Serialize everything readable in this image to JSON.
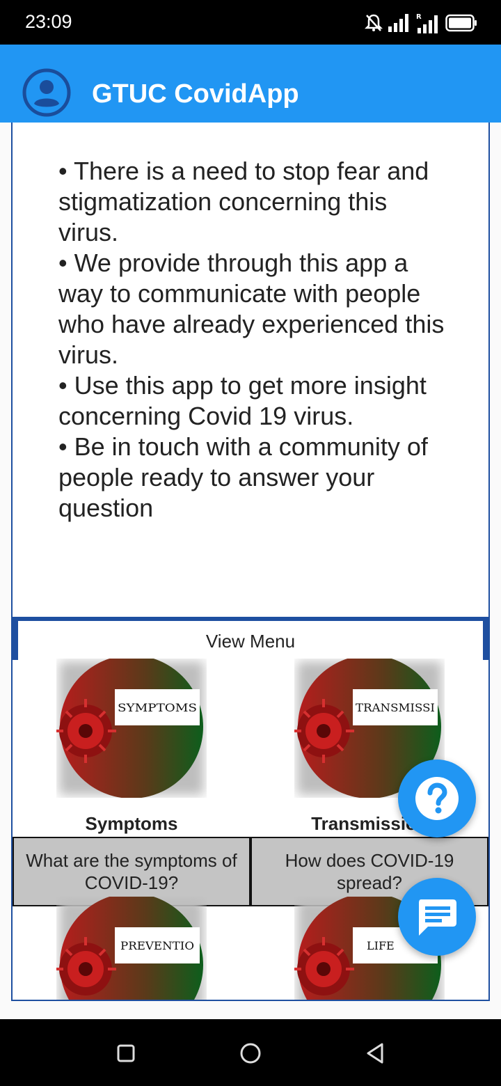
{
  "status_bar": {
    "time": "23:09",
    "icons": [
      "mute-icon",
      "signal-icon",
      "signal-roaming-icon",
      "battery-icon"
    ]
  },
  "app_bar": {
    "title": "GTUC CovidApp",
    "avatar_icon": "account-circle-icon"
  },
  "intro": {
    "paragraphs": [
      "• There is a need to stop fear and stigmatization concerning this virus.",
      "• We provide through this app a way to communicate with people who have already experienced this virus.",
      "• Use this app to get more insight concerning Covid 19 virus.",
      "• Be in touch with a community of people ready to answer your question"
    ]
  },
  "menu": {
    "label": "View Menu",
    "tiles": [
      {
        "image_text": "SYMPTOMS",
        "title": "Symptoms",
        "description": "What are the symptoms of COVID-19?"
      },
      {
        "image_text": "TRANSMISSI",
        "title": "Transmission",
        "description": "How does COVID-19 spread?"
      },
      {
        "image_text": "PREVENTIO",
        "title": "",
        "description": ""
      },
      {
        "image_text": "LIFE",
        "title": "",
        "description": ""
      }
    ]
  },
  "fabs": {
    "help_icon": "help-icon",
    "chat_icon": "chat-icon"
  },
  "colors": {
    "primary": "#2196f3",
    "border": "#1e4fa0",
    "tile_desc_bg": "#c4c4c4"
  }
}
